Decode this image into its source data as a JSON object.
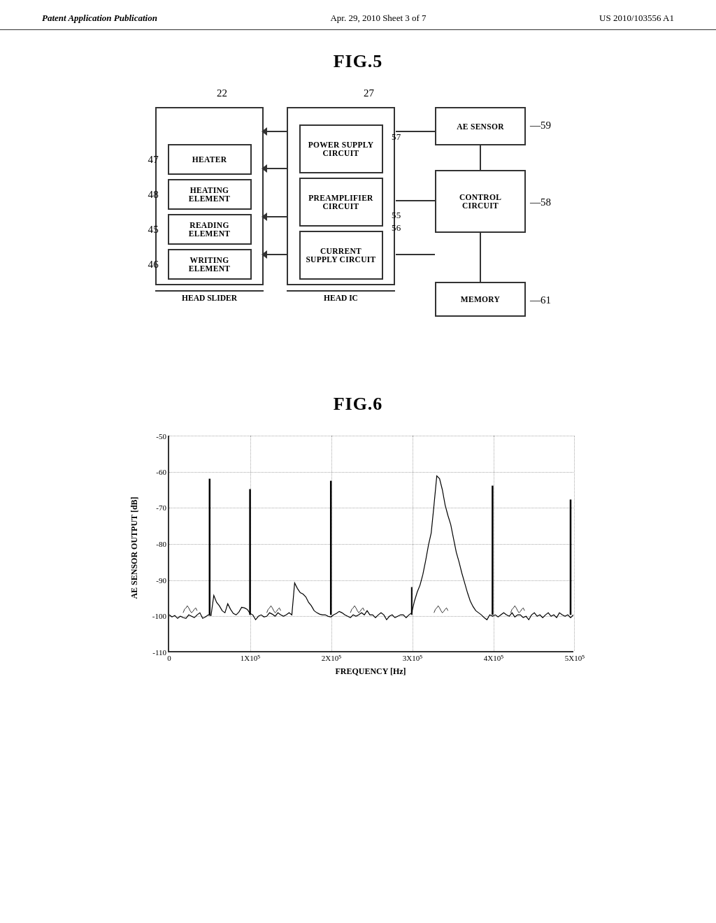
{
  "header": {
    "left": "Patent Application Publication",
    "center": "Apr. 29, 2010  Sheet 3 of 7",
    "right": "US 2010/103556 A1"
  },
  "fig5": {
    "title": "FIG.5",
    "labels": {
      "n22": "22",
      "n27": "27",
      "n47": "47",
      "n48": "48",
      "n45": "45",
      "n46": "46",
      "n55": "55",
      "n56": "56",
      "n57": "57",
      "n58": "58",
      "n59": "59",
      "n61": "61"
    },
    "boxes": {
      "heater": "HEATER",
      "heating_element": "HEATING\nELEMENT",
      "reading_element": "READING\nELEMENT",
      "writing_element": "WRITING\nELEMENT",
      "head_slider": "HEAD SLIDER",
      "power_supply": "POWER SUPPLY\nCIRCUIT",
      "preamplifier": "PREAMPLIFIER\nCIRCUIT",
      "current_supply": "CURRENT\nSUPPLY CIRCUIT",
      "head_ic": "HEAD IC",
      "ae_sensor": "AE SENSOR",
      "control_circuit": "CONTROL\nCIRCUIT",
      "memory": "MEMORY"
    }
  },
  "fig6": {
    "title": "FIG.6",
    "y_axis_label": "AE SENSOR OUTPUT [dB]",
    "x_axis_label": "FREQUENCY [Hz]",
    "y_ticks": [
      "-50",
      "-60",
      "-70",
      "-80",
      "-90",
      "-100",
      "-110"
    ],
    "x_ticks": [
      "0",
      "1X10⁵",
      "2X10⁵",
      "3X10⁵",
      "4X10⁵",
      "5X10⁵"
    ]
  }
}
